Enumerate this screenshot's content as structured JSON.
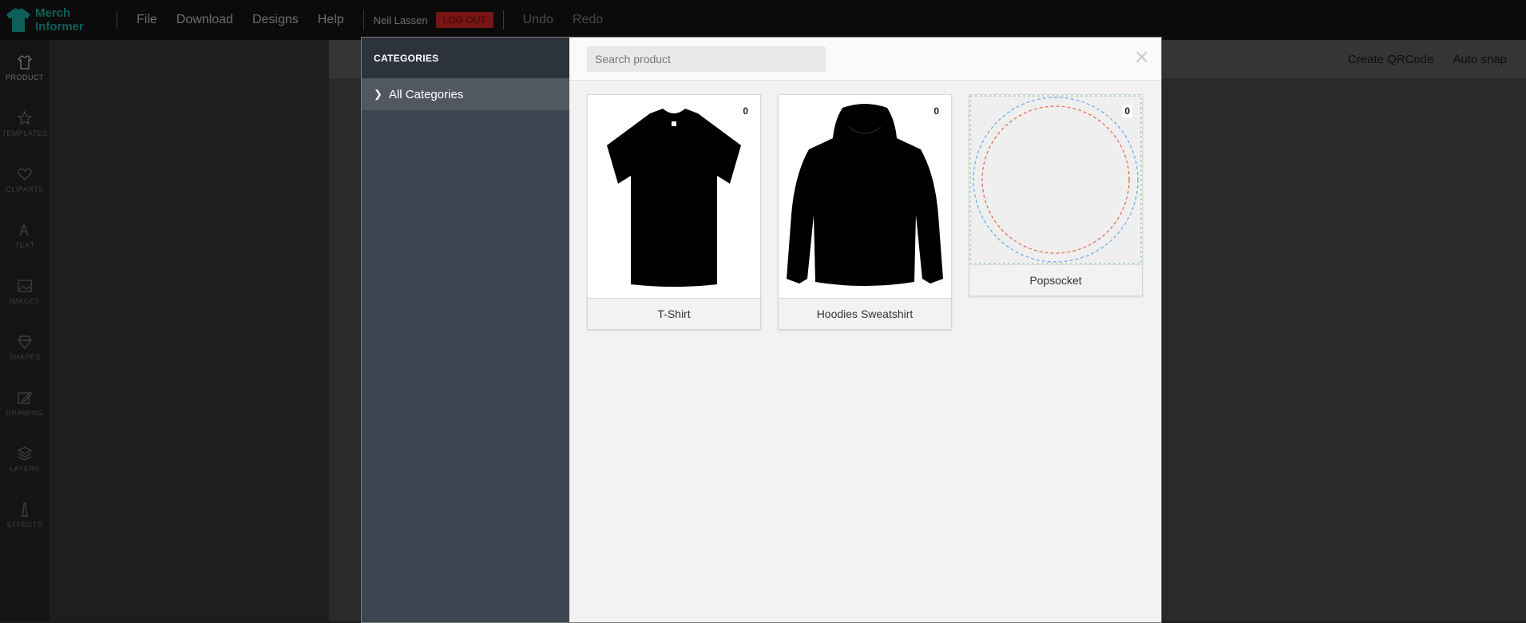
{
  "app": {
    "logo_line1": "Merch",
    "logo_line2": "Informer"
  },
  "topbar": {
    "menu": [
      {
        "label": "File"
      },
      {
        "label": "Download"
      },
      {
        "label": "Designs"
      },
      {
        "label": "Help"
      }
    ],
    "username": "Neil Lassen",
    "logout_label": "LOG OUT",
    "undo_label": "Undo",
    "redo_label": "Redo"
  },
  "left_rail": [
    {
      "label": "PRODUCT",
      "icon": "tshirt-icon"
    },
    {
      "label": "TEMPLATES",
      "icon": "star-icon"
    },
    {
      "label": "CLIPARTS",
      "icon": "heart-icon"
    },
    {
      "label": "TEXT",
      "icon": "text-icon"
    },
    {
      "label": "IMAGES",
      "icon": "image-icon"
    },
    {
      "label": "SHAPES",
      "icon": "gem-icon"
    },
    {
      "label": "DRAWING",
      "icon": "pencil-icon"
    },
    {
      "label": "LAYERS",
      "icon": "layers-icon"
    },
    {
      "label": "EFFECTS",
      "icon": "effects-icon"
    }
  ],
  "canvas_header": {
    "qrcode_label": "Create QRCode",
    "autosnap_label": "Auto snap"
  },
  "modal": {
    "categories_title": "CATEGORIES",
    "categories": [
      {
        "label": "All Categories"
      }
    ],
    "search_placeholder": "Search product",
    "close_icon": "close-icon",
    "products": [
      {
        "name": "T-Shirt",
        "count": "0",
        "icon": "tshirt-image"
      },
      {
        "name": "Hoodies Sweatshirt",
        "count": "0",
        "icon": "hoodie-image"
      },
      {
        "name": "Popsocket",
        "count": "0",
        "icon": "popsocket-image"
      }
    ]
  },
  "colors": {
    "modal_sidebar": "#3d4550",
    "categories_header": "#2c333d",
    "logout_bg": "#7a1515",
    "logo": "#0e5f5a"
  }
}
